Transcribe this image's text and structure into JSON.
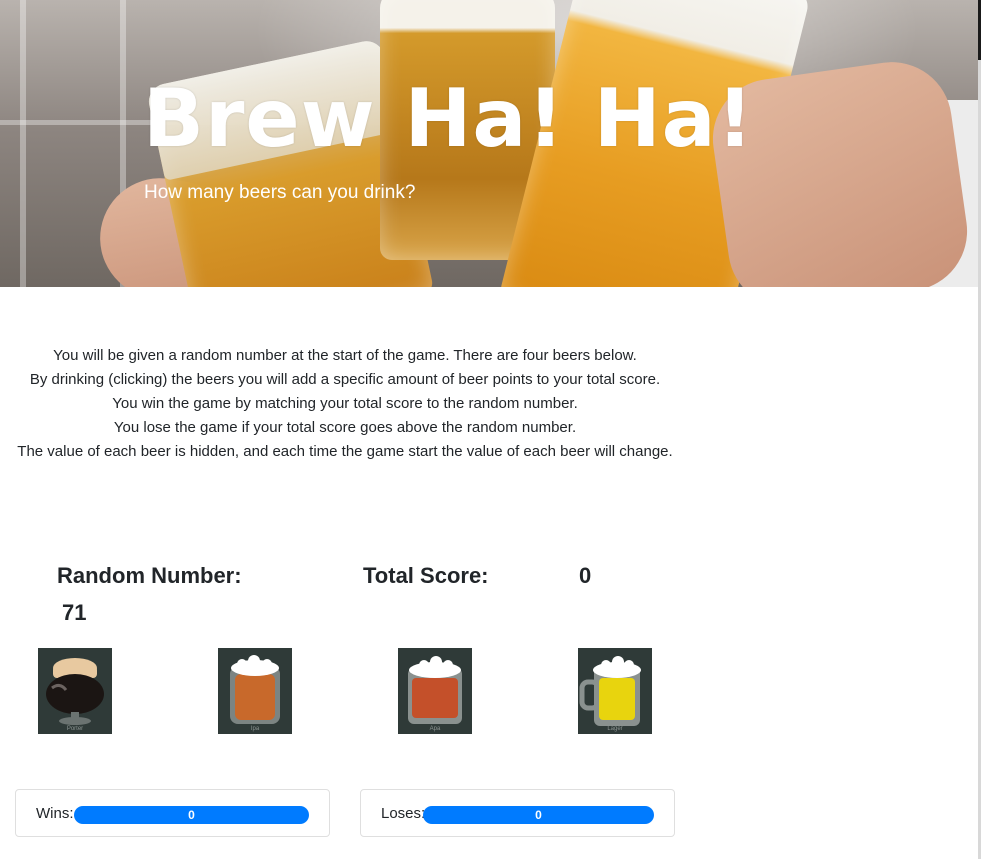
{
  "hero": {
    "title": "Brew Ha! Ha!",
    "subtitle": "How many beers can you drink?"
  },
  "instructions": {
    "lines": [
      "You will be given a random number at the start of the game. There are four beers below.",
      "By drinking (clicking) the beers you will add a specific amount of beer points to your total score.",
      "You win the game by matching your total score to the random number.",
      "You lose the game if your total score goes above the random number.",
      "The value of each beer is hidden, and each time the game start the value of each beer will change."
    ]
  },
  "game": {
    "random_label": "Random Number:",
    "random_value": "71",
    "total_label": "Total Score:",
    "total_value": "0"
  },
  "beers": [
    {
      "name": "Porter",
      "icon": "porter-beer-icon",
      "color": "#1b1513",
      "foam": "#e8c9a0"
    },
    {
      "name": "Ipa",
      "icon": "ipa-beer-icon",
      "color": "#c8692b",
      "foam": "#ffffff"
    },
    {
      "name": "Apa",
      "icon": "apa-beer-icon",
      "color": "#c4502a",
      "foam": "#ffffff"
    },
    {
      "name": "Lager",
      "icon": "lager-beer-icon",
      "color": "#e8d40e",
      "foam": "#ffffff"
    }
  ],
  "stats": {
    "wins_label": "Wins:",
    "wins_value": "0",
    "loses_label": "Loses:",
    "loses_value": "0",
    "bar_color": "#007bff"
  }
}
